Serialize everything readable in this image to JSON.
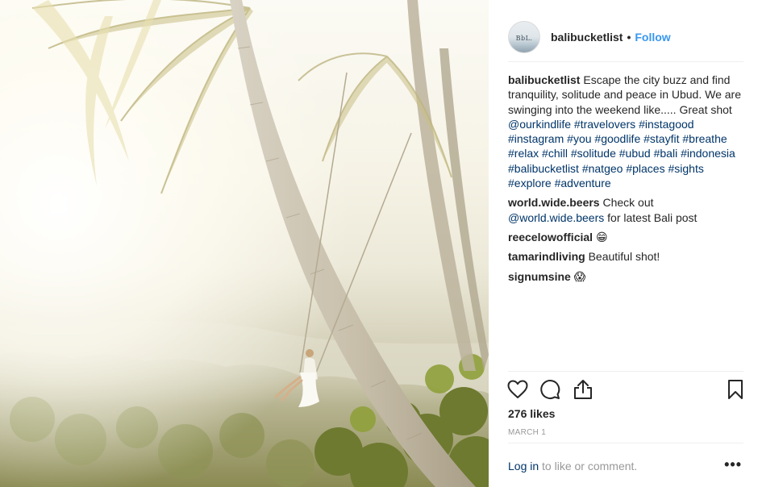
{
  "post": {
    "username": "balibucketlist",
    "separator": "•",
    "follow_label": "Follow",
    "avatar_text": "BbL.",
    "likes": "276 likes",
    "date": "MARCH 1"
  },
  "caption": {
    "author": "balibucketlist",
    "text": "Escape the city buzz and find tranquility, solitude and peace in Ubud. We are swinging into the weekend like..... Great shot",
    "mention": "@ourkindlife",
    "hashtags": [
      "#travelovers",
      "#instagood",
      "#instagram",
      "#you",
      "#goodlife",
      "#stayfit",
      "#breathe",
      "#relax",
      "#chill",
      "#solitude",
      "#ubud",
      "#bali",
      "#indonesia",
      "#balibucketlist",
      "#natgeo",
      "#places",
      "#sights",
      "#explore",
      "#adventure"
    ]
  },
  "comments": [
    {
      "author": "world.wide.beers",
      "text_before": "Check out",
      "mention": "@world.wide.beers",
      "text_after": "for latest Bali post"
    },
    {
      "author": "reecelowofficial",
      "emoji": "😁"
    },
    {
      "author": "tamarindliving",
      "text": "Beautiful shot!"
    },
    {
      "author": "signumsine",
      "emoji": "😱"
    }
  ],
  "footer": {
    "login_label": "Log in",
    "prompt": "to like or comment.",
    "more_label": "•••"
  },
  "icons": {
    "like": "heart-icon",
    "comment": "comment-bubble-icon",
    "share": "share-icon",
    "save": "bookmark-icon",
    "more": "more-options-icon"
  },
  "colors": {
    "follow": "#3897f0",
    "link": "#003569",
    "muted": "#999999",
    "text": "#262626"
  }
}
